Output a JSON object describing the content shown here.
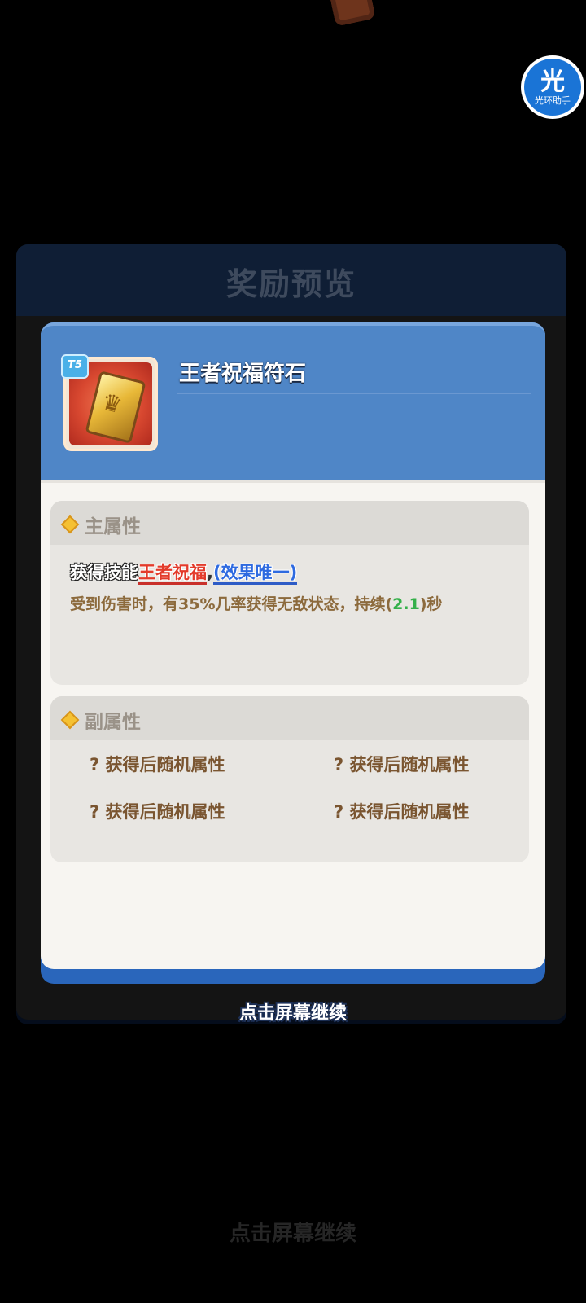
{
  "helper": {
    "glyph": "光",
    "label": "光环助手"
  },
  "background_panel": {
    "title": "奖励预览"
  },
  "item": {
    "tier": "T5",
    "name": "王者祝福符石",
    "icon": "rune-stone-icon"
  },
  "main_attribute": {
    "title": "主属性",
    "prefix": "获得技能",
    "skill_name": "王者祝福",
    "comma": ",",
    "unique_tag": "(效果唯一)",
    "desc_before": "受到伤害时，有35%几率获得无敌状态，持续(",
    "desc_value": "2.1",
    "desc_after": ")秒"
  },
  "sub_attribute": {
    "title": "副属性",
    "items": [
      "? 获得后随机属性",
      "? 获得后随机属性",
      "? 获得后随机属性",
      "? 获得后随机属性"
    ]
  },
  "continue_prompt": "点击屏幕继续",
  "background_continue_prompt": "点击屏幕继续",
  "colors": {
    "card_header": "#4f86c7",
    "skill_name": "#e33b2b",
    "unique_tag": "#2e6ae0",
    "duration_value": "#34b04a"
  }
}
